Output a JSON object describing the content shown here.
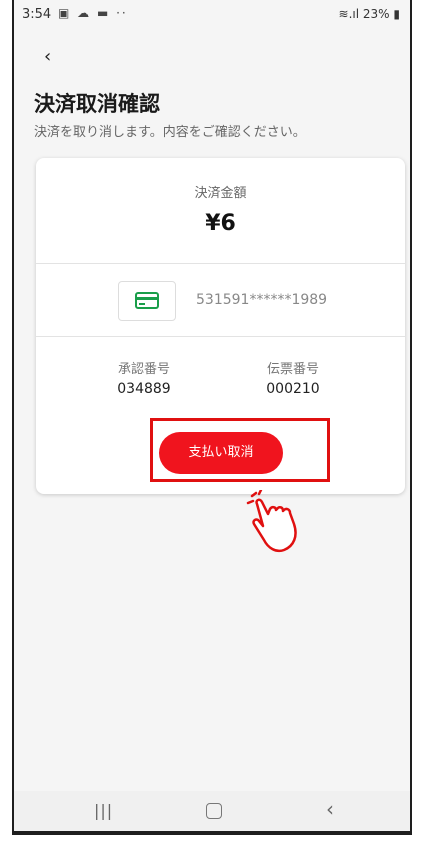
{
  "status_bar": {
    "time": "3:54",
    "battery": "23%"
  },
  "header": {
    "title": "決済取消確認",
    "subtitle": "決済を取り消します。内容をご確認ください。"
  },
  "payment": {
    "amount_label": "決済金額",
    "amount_value": "¥6",
    "card_number": "531591******1989",
    "approval_label": "承認番号",
    "approval_value": "034889",
    "slip_label": "伝票番号",
    "slip_value": "000210"
  },
  "actions": {
    "cancel_label": "支払い取消"
  },
  "colors": {
    "accent_red": "#f0141e",
    "card_icon_green": "#1a9e4a"
  }
}
